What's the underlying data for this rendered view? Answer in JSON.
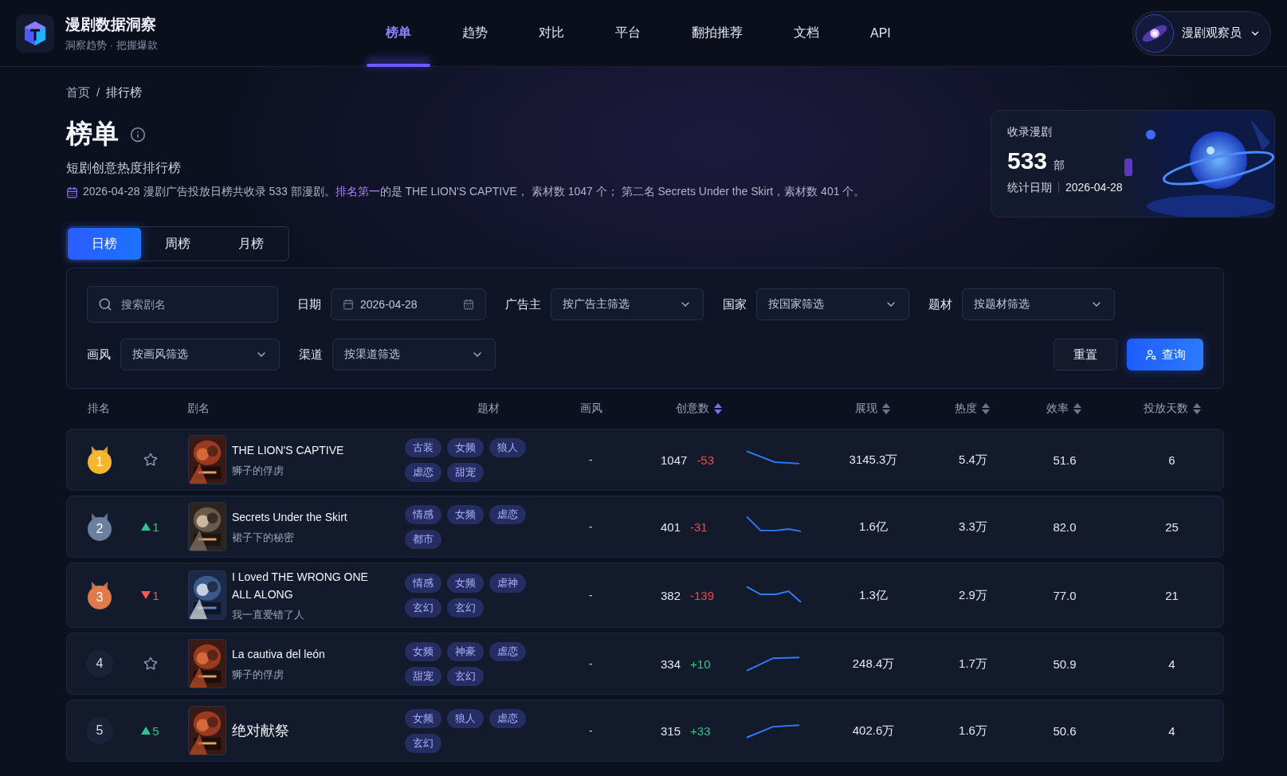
{
  "brand": {
    "title": "漫剧数据洞察",
    "subtitle": "洞察趋势 · 把握爆款"
  },
  "nav": [
    {
      "label": "榜单",
      "selected": true
    },
    {
      "label": "趋势",
      "selected": false
    },
    {
      "label": "对比",
      "selected": false
    },
    {
      "label": "平台",
      "selected": false
    },
    {
      "label": "翻拍推荐",
      "selected": false
    },
    {
      "label": "文档",
      "selected": false
    },
    {
      "label": "API",
      "selected": false
    }
  ],
  "user": {
    "name": "漫剧观察员"
  },
  "breadcrumb": {
    "items": [
      "首页",
      "排行榜"
    ],
    "separator": "/"
  },
  "page": {
    "title": "榜单",
    "subtitle": "短剧创意热度排行榜",
    "summary": "2026-04-28 漫剧广告投放日榜共收录 533 部漫剧。**排名第一**的是 THE LION'S CAPTIVE， 素材数 1047 个； 第二名 Secrets Under the Skirt，素材数 401 个。"
  },
  "stats": {
    "label": "收录漫剧",
    "value": "533",
    "unit": "部",
    "date_label": "统计日期",
    "date": "2026-04-28"
  },
  "period_tabs": [
    {
      "label": "日榜",
      "selected": true
    },
    {
      "label": "周榜",
      "selected": false
    },
    {
      "label": "月榜",
      "selected": false
    }
  ],
  "filters": {
    "search_placeholder": "搜索剧名",
    "date_label": "日期",
    "date_value": "2026-04-28",
    "selects": [
      {
        "label": "广告主",
        "placeholder": "按广告主筛选"
      },
      {
        "label": "国家",
        "placeholder": "按国家筛选"
      },
      {
        "label": "题材",
        "placeholder": "按题材筛选"
      },
      {
        "label": "画风",
        "placeholder": "按画风筛选"
      },
      {
        "label": "渠道",
        "placeholder": "按渠道筛选"
      }
    ],
    "reset": "重置",
    "query": "查询"
  },
  "columns": [
    {
      "label": "排名",
      "kind": "plain"
    },
    {
      "label": "剧名",
      "kind": "plain"
    },
    {
      "label": "题材",
      "kind": "plain"
    },
    {
      "label": "画风",
      "kind": "plain"
    },
    {
      "label": "创意数",
      "kind": "sorted"
    },
    {
      "label": "展现",
      "kind": "sortable"
    },
    {
      "label": "热度",
      "kind": "sortable"
    },
    {
      "label": "效率",
      "kind": "sortable"
    },
    {
      "label": "投放天数",
      "kind": "sortable"
    }
  ],
  "rows": [
    {
      "rank": "1",
      "kind": "gold",
      "change": {
        "kind": "star"
      },
      "title": "THE LION'S CAPTIVE",
      "subtitle": "狮子的俘虏",
      "tags": [
        "古装",
        "女频",
        "狼人",
        "虐恋",
        "甜宠"
      ],
      "style": "-",
      "creatives": "1047",
      "delta": {
        "text": "-53",
        "kind": "down"
      },
      "impressions": "3145.3万",
      "heat": "5.4万",
      "efficiency": "51.6",
      "days": "6"
    },
    {
      "rank": "2",
      "kind": "silver",
      "change": {
        "kind": "up",
        "text": "1"
      },
      "title": "Secrets Under the Skirt",
      "subtitle": "裙子下的秘密",
      "tags": [
        "情感",
        "女频",
        "虐恋",
        "都市"
      ],
      "style": "-",
      "creatives": "401",
      "delta": {
        "text": "-31",
        "kind": "down"
      },
      "impressions": "1.6亿",
      "heat": "3.3万",
      "efficiency": "82.0",
      "days": "25"
    },
    {
      "rank": "3",
      "kind": "bronze",
      "change": {
        "kind": "down",
        "text": "1"
      },
      "title": "I Loved THE WRONG ONE ALL ALONG",
      "subtitle": "我一直爱错了人",
      "tags": [
        "情感",
        "女频",
        "虐神",
        "玄幻",
        "玄幻"
      ],
      "style": "-",
      "creatives": "382",
      "delta": {
        "text": "-139",
        "kind": "down"
      },
      "impressions": "1.3亿",
      "heat": "2.9万",
      "efficiency": "77.0",
      "days": "21"
    },
    {
      "rank": "4",
      "kind": "plain",
      "change": {
        "kind": "star"
      },
      "title": "La cautiva del león",
      "subtitle": "狮子的俘虏",
      "tags": [
        "女频",
        "神豪",
        "虐恋",
        "甜宠",
        "玄幻"
      ],
      "style": "-",
      "creatives": "334",
      "delta": {
        "text": "+10",
        "kind": "up"
      },
      "impressions": "248.4万",
      "heat": "1.7万",
      "efficiency": "50.9",
      "days": "4"
    },
    {
      "rank": "5",
      "kind": "plain",
      "change": {
        "kind": "up",
        "text": "5"
      },
      "title": "绝对献祭",
      "tags": [
        "女频",
        "狼人",
        "虐恋",
        "玄幻"
      ],
      "style": "-",
      "creatives": "315",
      "delta": {
        "text": "+33",
        "kind": "up"
      },
      "impressions": "402.6万",
      "heat": "1.6万",
      "efficiency": "50.6",
      "days": "4"
    }
  ]
}
